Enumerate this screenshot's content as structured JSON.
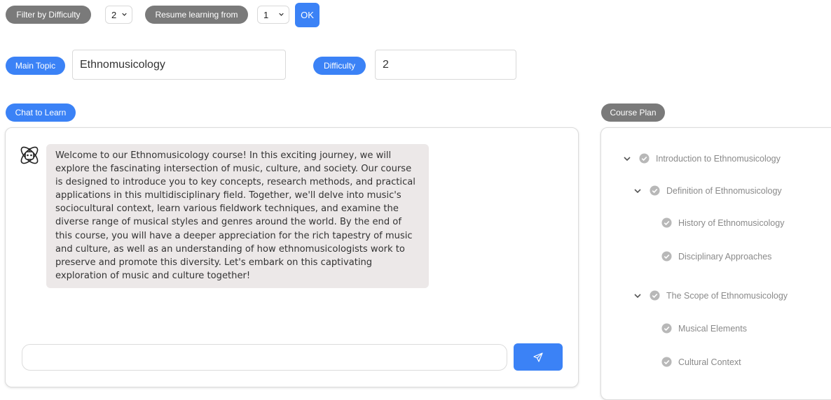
{
  "toolbar": {
    "filter_label": "Filter by Difficulty",
    "difficulty_value": "2",
    "resume_label": "Resume learning from",
    "resume_value": "1",
    "ok_label": "OK"
  },
  "topic": {
    "main_topic_label": "Main Topic",
    "main_topic_value": "Ethnomusicology",
    "difficulty_label": "Difficulty",
    "difficulty_value": "2"
  },
  "chat": {
    "header_label": "Chat to Learn",
    "bot_avatar_icon": "atom-robot-icon",
    "messages": [
      {
        "role": "assistant",
        "text": "Welcome to our Ethnomusicology course! In this exciting journey, we will explore the fascinating intersection of music, culture, and society. Our course is designed to introduce you to key concepts, research methods, and practical applications in this multidisciplinary field. Together, we'll delve into music's sociocultural context, learn various fieldwork techniques, and examine the diverse range of musical styles and genres around the world. By the end of this course, you will have a deeper appreciation for the rich tapestry of music and culture, as well as an understanding of how ethnomusicologists work to preserve and promote this diversity. Let's embark on this captivating exploration of music and culture together!"
      }
    ],
    "input_value": "",
    "send_icon": "send-icon"
  },
  "course_plan": {
    "header_label": "Course Plan",
    "items": [
      {
        "label": "Introduction to Ethnomusicology",
        "level": 0,
        "expanded": true
      },
      {
        "label": "Definition of Ethnomusicology",
        "level": 1,
        "expanded": true
      },
      {
        "label": "History of Ethnomusicology",
        "level": 2
      },
      {
        "label": "Disciplinary Approaches",
        "level": 2
      },
      {
        "label": "The Scope of Ethnomusicology",
        "level": 1,
        "expanded": true
      },
      {
        "label": "Musical Elements",
        "level": 2
      },
      {
        "label": "Cultural Context",
        "level": 2
      }
    ]
  },
  "colors": {
    "accent_blue": "#3b82f6",
    "pill_gray": "#7a7a7a",
    "bubble_bg": "#ece8e8",
    "tree_text": "#8a8a8a"
  }
}
